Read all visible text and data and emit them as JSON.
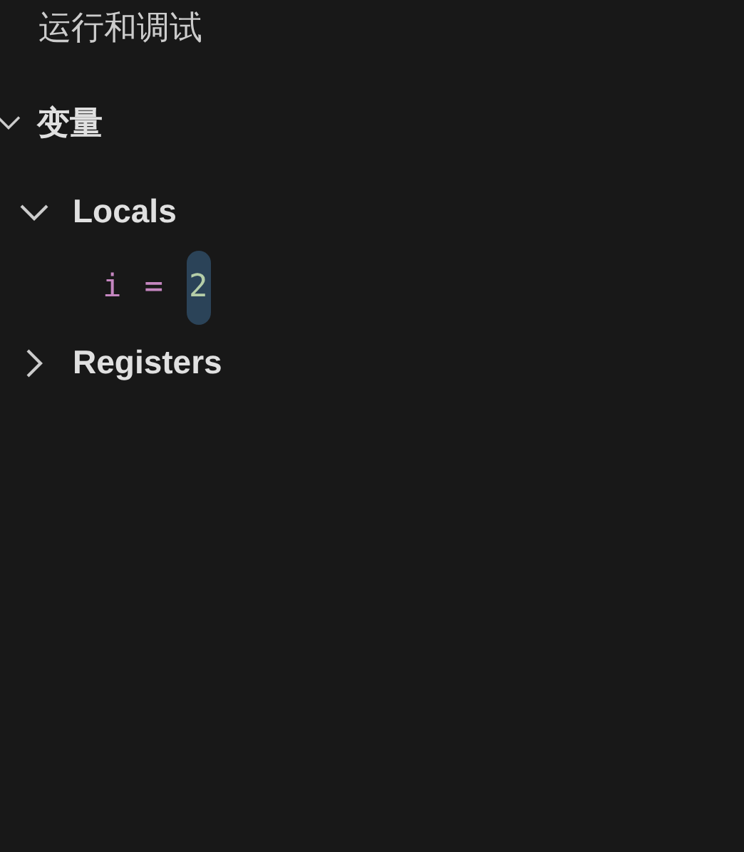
{
  "title": "运行和调试",
  "section": {
    "title": "变量",
    "expanded": true,
    "scopes": [
      {
        "name": "Locals",
        "expanded": true,
        "children": [
          {
            "name": "i",
            "separator": "=",
            "value": "2",
            "selected": true
          }
        ]
      },
      {
        "name": "Registers",
        "expanded": false
      }
    ]
  }
}
